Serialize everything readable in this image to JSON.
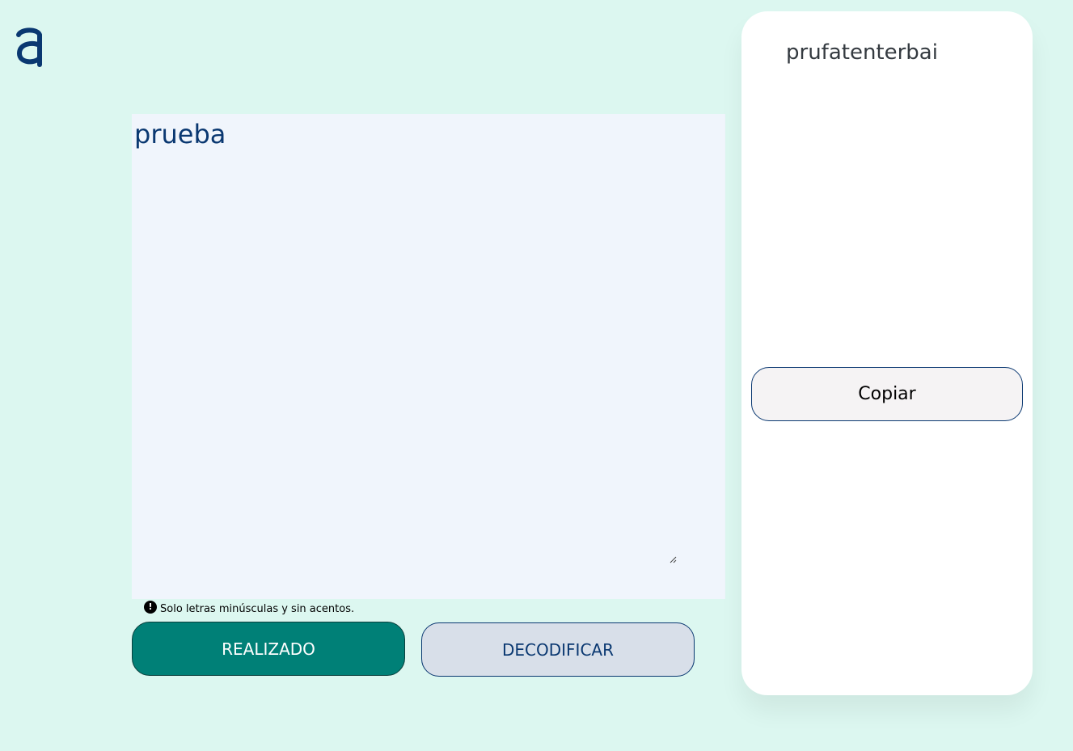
{
  "logo": {
    "name": "a-logo-icon",
    "color": "#0a3871"
  },
  "input": {
    "value": "prueba"
  },
  "hint": {
    "icon": "exclamation-circle-icon",
    "text": "Solo letras minúsculas y sin acentos."
  },
  "buttons": {
    "encrypt_label": "REALIZADO",
    "decrypt_label": "DECODIFICAR"
  },
  "output": {
    "text": "prufatenterbai",
    "copy_label": "Copiar"
  },
  "colors": {
    "background": "#dcf7f0",
    "primary": "#0a3871",
    "encrypt_button": "#008077",
    "decrypt_button": "#d8dfe9",
    "input_background": "#f0f5fc"
  }
}
